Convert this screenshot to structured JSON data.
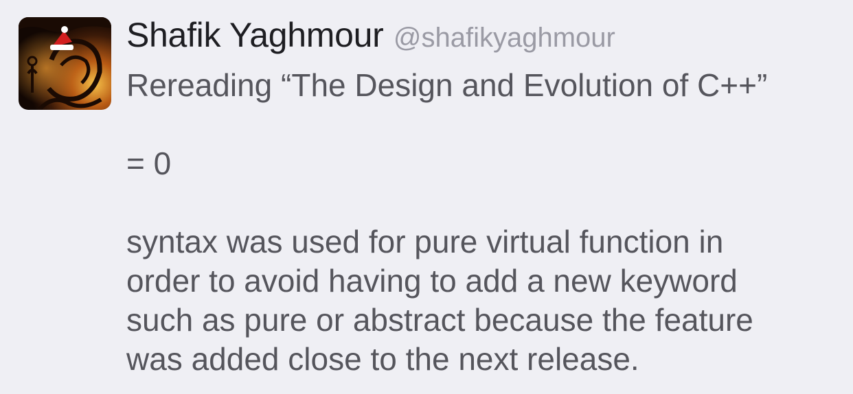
{
  "tweet": {
    "author": {
      "name": "Shafik Yaghmour",
      "handle": "@shafikyaghmour"
    },
    "lines": [
      "Rereading “The Design and Evolution of C++”",
      "",
      "= 0",
      "",
      "syntax was used for pure virtual function in",
      "order to avoid having to add a new keyword",
      "such as pure or abstract because the feature",
      "was added close to the next release."
    ]
  }
}
